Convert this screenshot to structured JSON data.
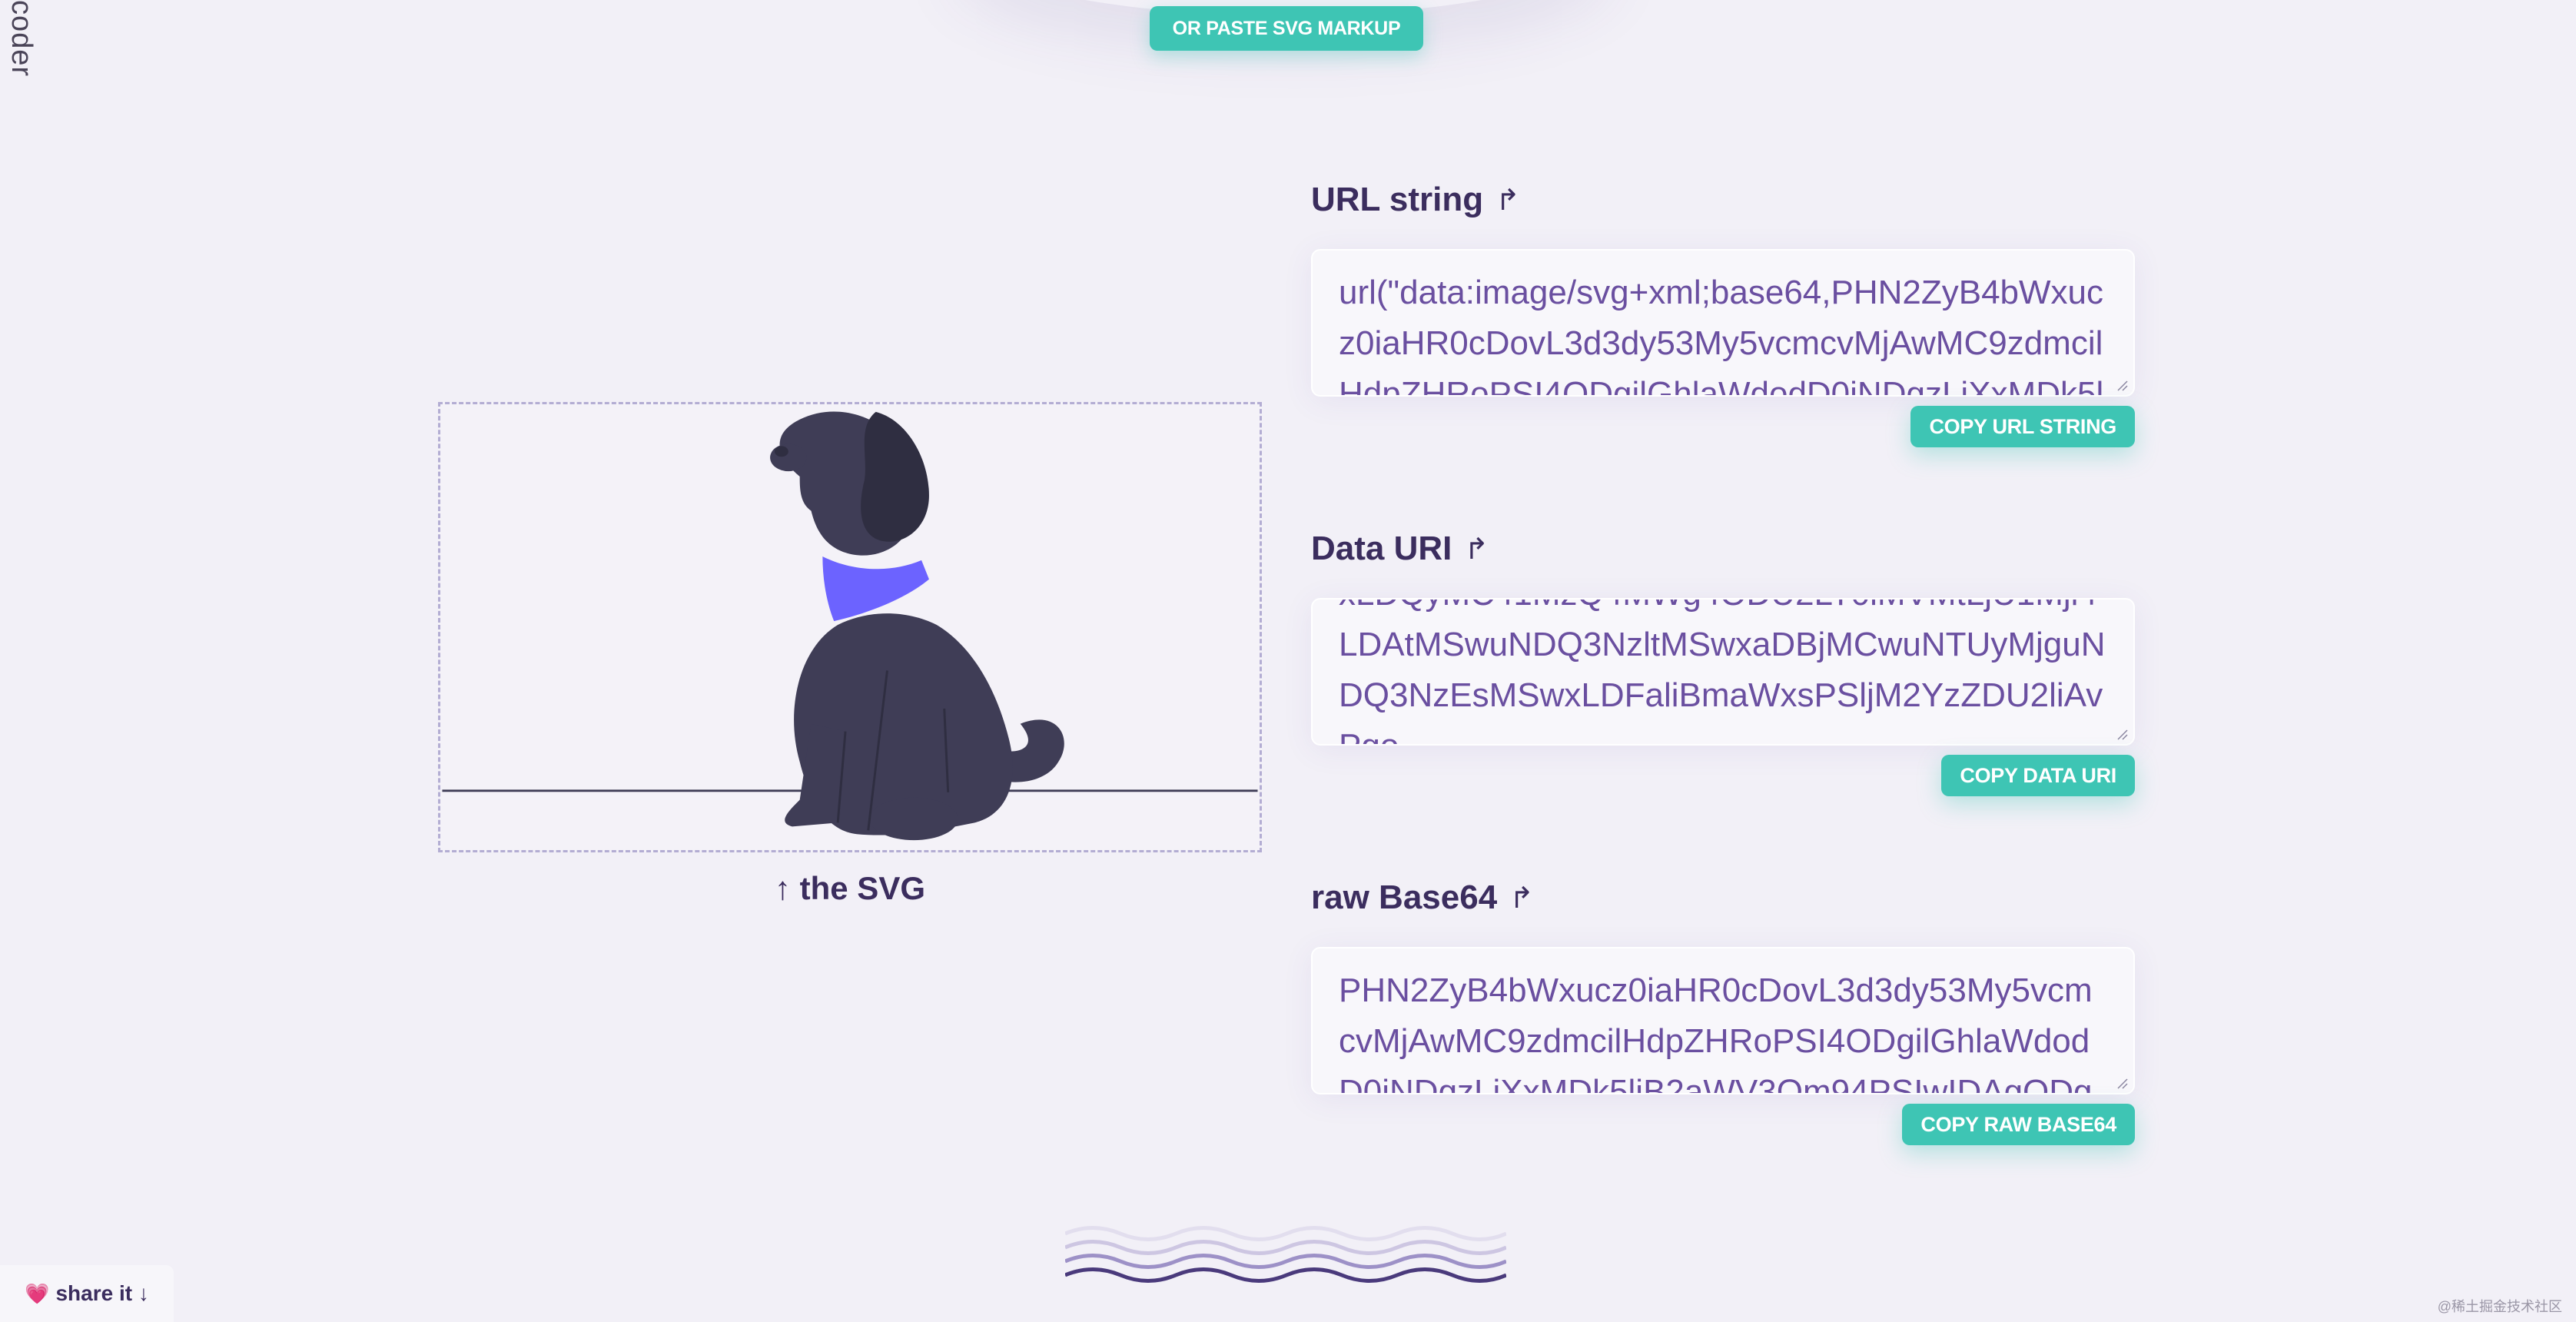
{
  "brand": {
    "vertical_text": "coder"
  },
  "paste_button": {
    "label": "OR PASTE SVG MARKUP"
  },
  "preview": {
    "caption": "↑ the SVG"
  },
  "outputs": [
    {
      "title": "URL string",
      "icon": "return-arrow-icon",
      "value": "url(\"data:image/svg+xml;base64,PHN2ZyB4bWxucz0iaHR0cDovL3d3dy53My5vcmcvMjAwMC9zdmcilHdpZHRoPSI4ODgilGhlaWdodD0iNDgzLiXxMDk5li",
      "copy_label": "COPY URL STRING"
    },
    {
      "title": "Data URI",
      "icon": "return-arrow-icon",
      "value": "xLDQyMC41MzQ4MWg4ODU2LT0iMVMtLjU1Mjl4LDAtMSwuNDQ3NzltMSwxaDBjMCwuNTUyMjguNDQ3NzEsMSwxLDFaliBmaWxsPSljM2YzZDU2liAvPgo",
      "copy_label": "COPY DATA URI"
    },
    {
      "title": "raw Base64",
      "icon": "return-arrow-icon",
      "value": "PHN2ZyB4bWxucz0iaHR0cDovL3d3dy53My5vcmcvMjAwMC9zdmcilHdpZHRoPSI4ODgilGhlaWdodD0iNDgzLiXxMDk5liB2aWV3Qm94PSIwIDAgODg4ID",
      "copy_label": "COPY RAW BASE64"
    }
  ],
  "share": {
    "label": "share it ↓",
    "icon": "heart-icon"
  },
  "watermark": "@稀土掘金技术社区",
  "colors": {
    "accent": "#3ec5b4",
    "text_dark": "#3b2d5e",
    "code_text": "#6a4fa0",
    "dog_body": "#3f3d56",
    "dog_collar": "#6c63ff"
  }
}
